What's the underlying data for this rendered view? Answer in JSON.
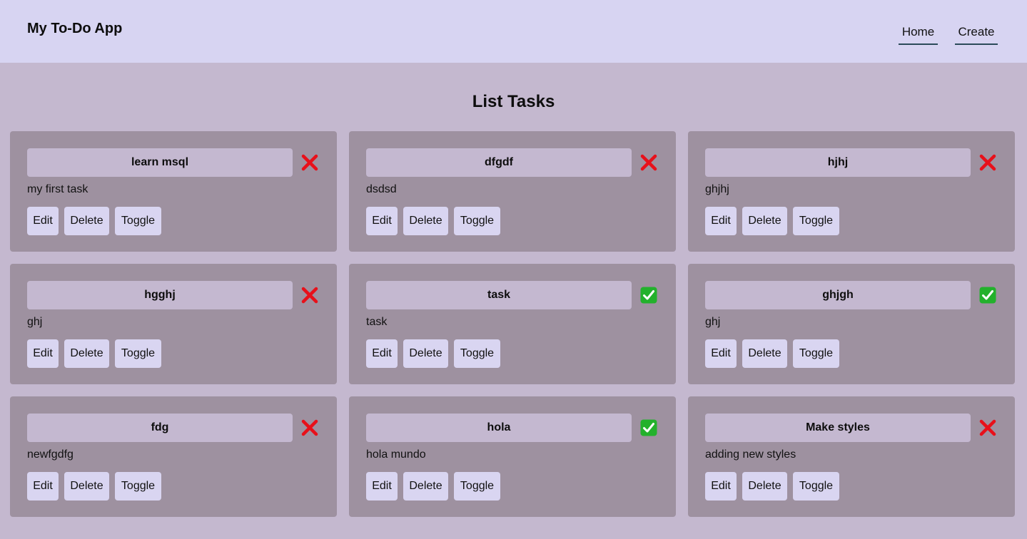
{
  "header": {
    "app_title": "My To-Do App",
    "nav": [
      {
        "label": "Home"
      },
      {
        "label": "Create"
      }
    ]
  },
  "page": {
    "title": "List Tasks"
  },
  "buttons": {
    "edit": "Edit",
    "delete": "Delete",
    "toggle": "Toggle"
  },
  "colors": {
    "header_bg": "#d7d4f2",
    "page_bg": "#c4b8cf",
    "card_bg": "#9e91a0",
    "title_bg": "#c4b8d0",
    "button_bg": "#d9d5f1",
    "incomplete_red": "#e8101a",
    "complete_green": "#23b12c"
  },
  "tasks": [
    {
      "title": "learn msql",
      "description": "my first task",
      "completed": false,
      "status_icon": "cross-mark-icon"
    },
    {
      "title": "dfgdf",
      "description": "dsdsd",
      "completed": false,
      "status_icon": "cross-mark-icon"
    },
    {
      "title": "hjhj",
      "description": "ghjhj",
      "completed": false,
      "status_icon": "cross-mark-icon"
    },
    {
      "title": "hgghj",
      "description": "ghj",
      "completed": false,
      "status_icon": "cross-mark-icon"
    },
    {
      "title": "task",
      "description": "task",
      "completed": true,
      "status_icon": "check-mark-icon"
    },
    {
      "title": "ghjgh",
      "description": "ghj",
      "completed": true,
      "status_icon": "check-mark-icon"
    },
    {
      "title": "fdg",
      "description": "newfgdfg",
      "completed": false,
      "status_icon": "cross-mark-icon"
    },
    {
      "title": "hola",
      "description": "hola mundo",
      "completed": true,
      "status_icon": "check-mark-icon"
    },
    {
      "title": "Make styles",
      "description": "adding new styles",
      "completed": false,
      "status_icon": "cross-mark-icon"
    }
  ]
}
